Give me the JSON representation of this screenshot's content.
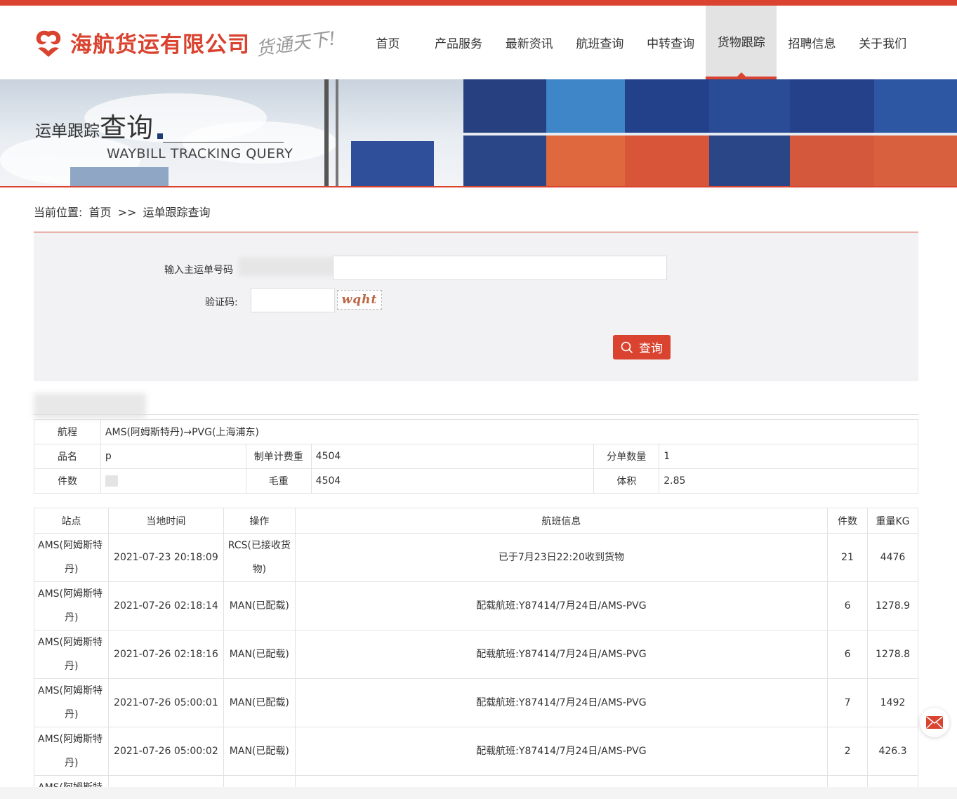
{
  "header": {
    "logo_text": "海航货运有限公司",
    "slogan": "货通天下!",
    "nav": [
      "首页",
      "产品服务",
      "最新资讯",
      "航班查询",
      "中转查询",
      "货物跟踪",
      "招聘信息",
      "关于我们"
    ],
    "active_nav_index": 5,
    "accent_color": "#d9432f"
  },
  "banner": {
    "title_small": "运单跟踪",
    "title_big": "查询",
    "subtitle": "WAYBILL TRACKING QUERY"
  },
  "breadcrumb": {
    "prefix": "当前位置:",
    "home": "首页",
    "sep": ">>",
    "current": "运单跟踪查询"
  },
  "form": {
    "waybill_label": "输入主运单号码",
    "waybill_value": "",
    "captcha_label": "验证码:",
    "captcha_value": "",
    "captcha_text": "wqht",
    "query_button": "查询"
  },
  "summary": {
    "route_label": "航程",
    "route_value": "AMS(阿姆斯特丹)→PVG(上海浦东)",
    "name_label": "品名",
    "name_value": "p",
    "charge_weight_label": "制单计费重",
    "charge_weight_value": "4504",
    "sub_count_label": "分单数量",
    "sub_count_value": "1",
    "pieces_label": "件数",
    "pieces_value": "",
    "gross_weight_label": "毛重",
    "gross_weight_value": "4504",
    "volume_label": "体积",
    "volume_value": "2.85"
  },
  "tracking": {
    "headers": [
      "站点",
      "当地时间",
      "操作",
      "航班信息",
      "件数",
      "重量KG"
    ],
    "rows": [
      {
        "station_a": "AMS(阿姆斯特",
        "station_b": "丹)",
        "time": "2021-07-23 20:18:09",
        "op_a": "RCS(已接收货",
        "op_b": "物)",
        "flight": "已于7月23日22:20收到货物",
        "pieces": "21",
        "weight": "4476"
      },
      {
        "station_a": "AMS(阿姆斯特",
        "station_b": "丹)",
        "time": "2021-07-26 02:18:14",
        "op_a": "MAN(已配载)",
        "op_b": "",
        "flight": "配载航班:Y87414/7月24日/AMS-PVG",
        "pieces": "6",
        "weight": "1278.9"
      },
      {
        "station_a": "AMS(阿姆斯特",
        "station_b": "丹)",
        "time": "2021-07-26 02:18:16",
        "op_a": "MAN(已配载)",
        "op_b": "",
        "flight": "配载航班:Y87414/7月24日/AMS-PVG",
        "pieces": "6",
        "weight": "1278.8"
      },
      {
        "station_a": "AMS(阿姆斯特",
        "station_b": "丹)",
        "time": "2021-07-26 05:00:01",
        "op_a": "MAN(已配载)",
        "op_b": "",
        "flight": "配载航班:Y87414/7月24日/AMS-PVG",
        "pieces": "7",
        "weight": "1492"
      },
      {
        "station_a": "AMS(阿姆斯特",
        "station_b": "丹)",
        "time": "2021-07-26 05:00:02",
        "op_a": "MAN(已配载)",
        "op_b": "",
        "flight": "配载航班:Y87414/7月24日/AMS-PVG",
        "pieces": "2",
        "weight": "426.3"
      },
      {
        "station_a": "AMS(阿姆斯特",
        "station_b": "",
        "time": "",
        "op_a": "",
        "op_b": "",
        "flight": "",
        "pieces": "",
        "weight": ""
      }
    ]
  }
}
